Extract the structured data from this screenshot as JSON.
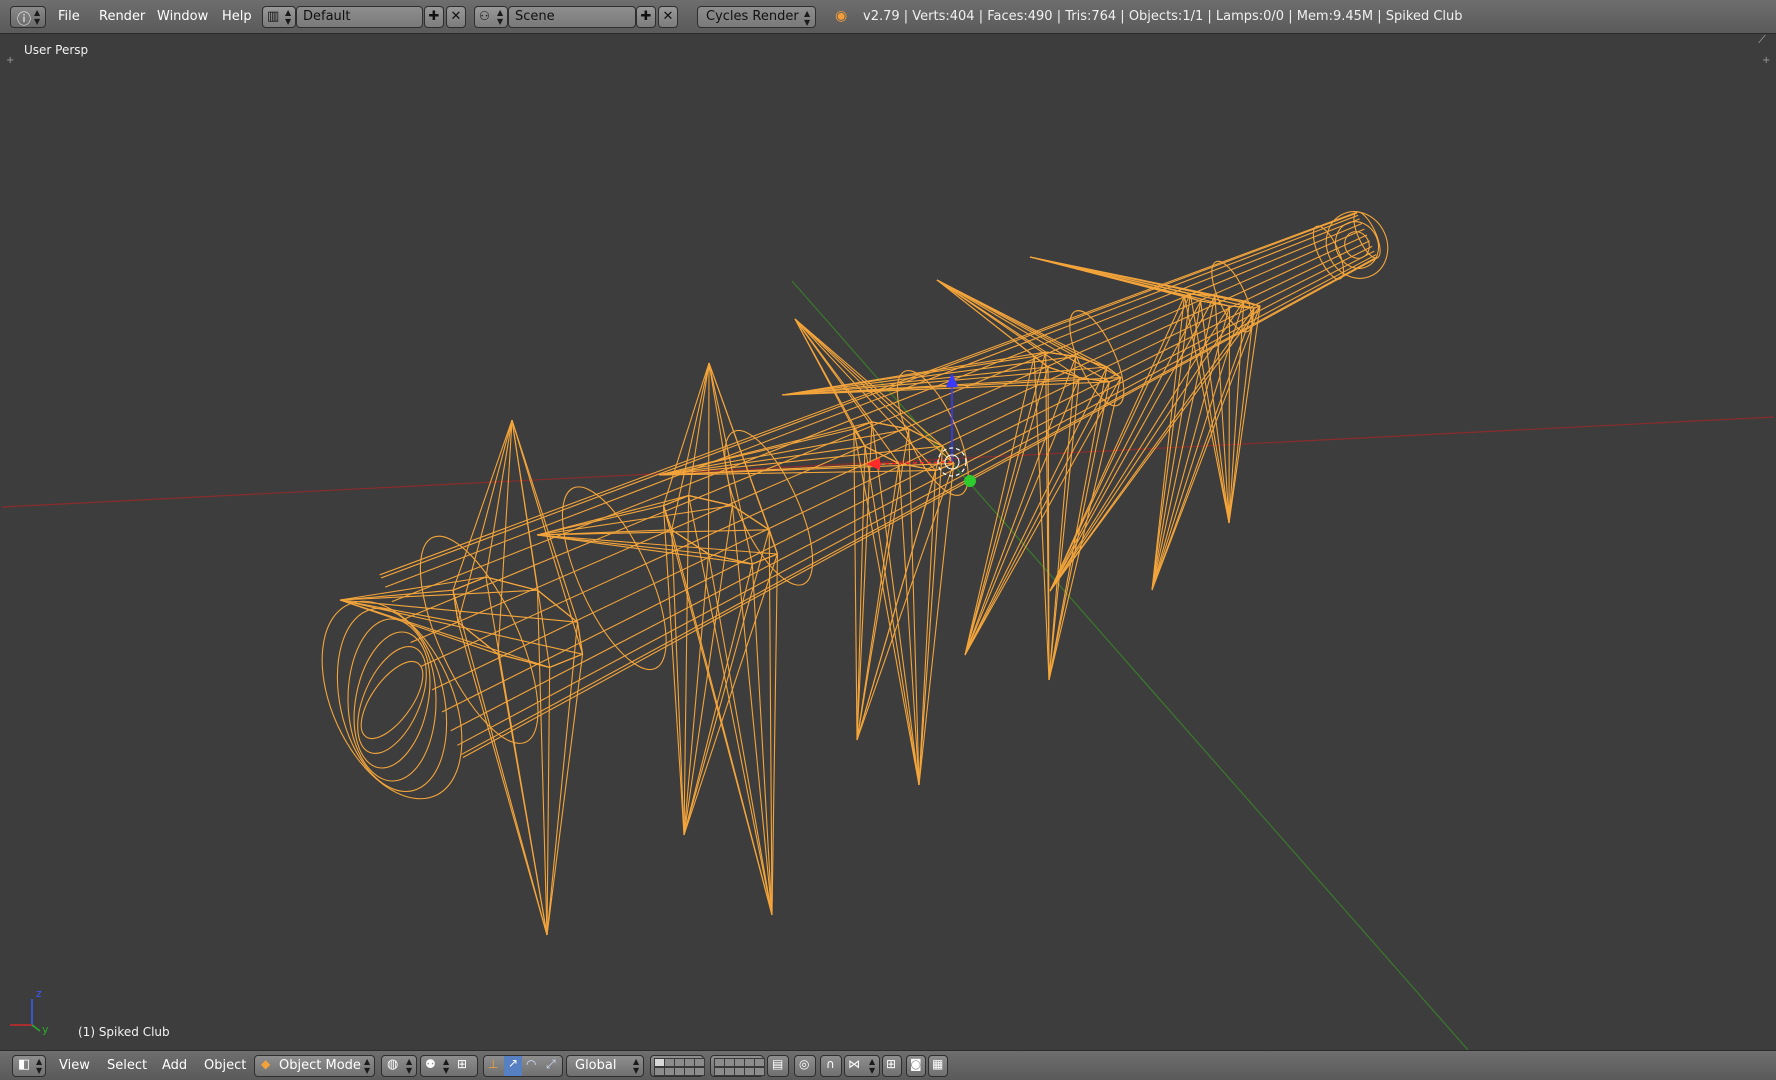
{
  "topbar": {
    "menus": [
      "File",
      "Render",
      "Window",
      "Help"
    ],
    "screen_layout": "Default",
    "scene": "Scene",
    "render_engine": "Cycles Render",
    "stats": "v2.79 | Verts:404 | Faces:490 | Tris:764 | Objects:1/1 | Lamps:0/0 | Mem:9.45M | Spiked Club"
  },
  "viewport": {
    "view_label": "User Persp",
    "object_label": "(1) Spiked Club",
    "axis_labels": {
      "z": "z",
      "y": "y"
    }
  },
  "bottombar": {
    "menus": [
      "View",
      "Select",
      "Add",
      "Object"
    ],
    "mode": "Object Mode",
    "orientation": "Global"
  },
  "colors": {
    "wire": "#f4a53b",
    "background": "#3d3d3d",
    "x_axis": "#9a2b2b",
    "y_axis": "#3f7f2f",
    "header": "#666666"
  }
}
